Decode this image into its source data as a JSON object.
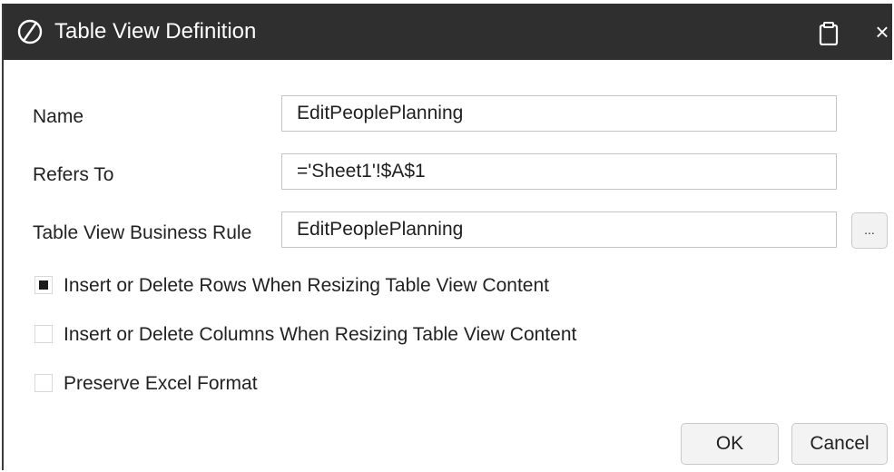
{
  "window": {
    "title": "Table View Definition",
    "logo_icon": "oracle-smart-view-logo-icon",
    "clipboard_icon": "clipboard-icon",
    "close_glyph": "×"
  },
  "form": {
    "name": {
      "label": "Name",
      "value": "EditPeoplePlanning"
    },
    "refers_to": {
      "label": "Refers To",
      "value": "='Sheet1'!$A$1"
    },
    "business_rule": {
      "label": "Table View Business Rule",
      "value": "EditPeoplePlanning",
      "browse_label": "..."
    }
  },
  "options": [
    {
      "label": "Insert or Delete Rows When Resizing Table View Content",
      "checked": true
    },
    {
      "label": "Insert or Delete Columns When Resizing Table View Content",
      "checked": false
    },
    {
      "label": "Preserve Excel Format",
      "checked": false
    }
  ],
  "buttons": {
    "ok": "OK",
    "cancel": "Cancel"
  },
  "colors": {
    "titlebar": "#2f2f2f",
    "title_text": "#ffffff",
    "checkbox_mark": "#1a1a1a"
  }
}
